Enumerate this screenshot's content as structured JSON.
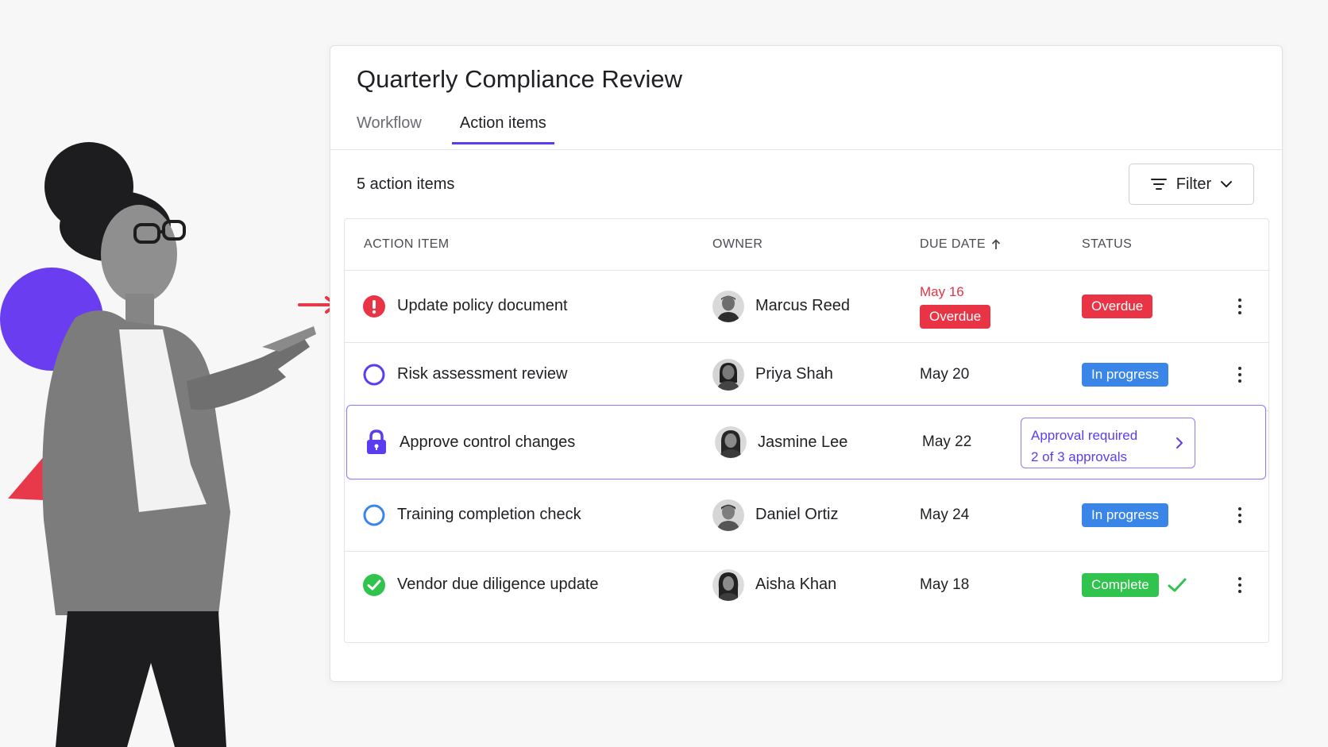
{
  "panel": {
    "title": "Quarterly Compliance Review",
    "tabs": [
      {
        "label": "Workflow",
        "active": false
      },
      {
        "label": "Action items",
        "active": true
      }
    ],
    "count_label": "5 action items",
    "filter_label": "Filter"
  },
  "table": {
    "headers": {
      "item": "ACTION ITEM",
      "owner": "OWNER",
      "due": "DUE DATE",
      "status": "STATUS"
    },
    "sort": {
      "column": "DUE DATE",
      "direction": "ascending"
    },
    "rows": [
      {
        "icon": "alert-icon",
        "item": "Update policy document",
        "owner": "Marcus Reed",
        "due": "May 16",
        "due_tag": "Overdue",
        "status": "Overdue"
      },
      {
        "icon": "in-progress-circle-icon",
        "item": "Risk assessment review",
        "owner": "Priya Shah",
        "due": "May 20",
        "status": "In progress"
      },
      {
        "icon": "lock-icon",
        "item": "Approve control changes",
        "owner": "Jasmine Lee",
        "due": "May 22",
        "status": "Approval required",
        "status_detail": "2 of 3 approvals"
      },
      {
        "icon": "in-progress-circle-icon",
        "item": "Training completion check",
        "owner": "Daniel Ortiz",
        "due": "May 24",
        "status": "In progress"
      },
      {
        "icon": "check-circle-icon",
        "item": "Vendor due diligence update",
        "owner": "Aisha Khan",
        "due": "May 18",
        "status": "Complete"
      }
    ]
  },
  "colors": {
    "accent": "#5a3df0",
    "overdue": "#e83444",
    "in_progress": "#3a86e8",
    "complete": "#30c44e"
  }
}
